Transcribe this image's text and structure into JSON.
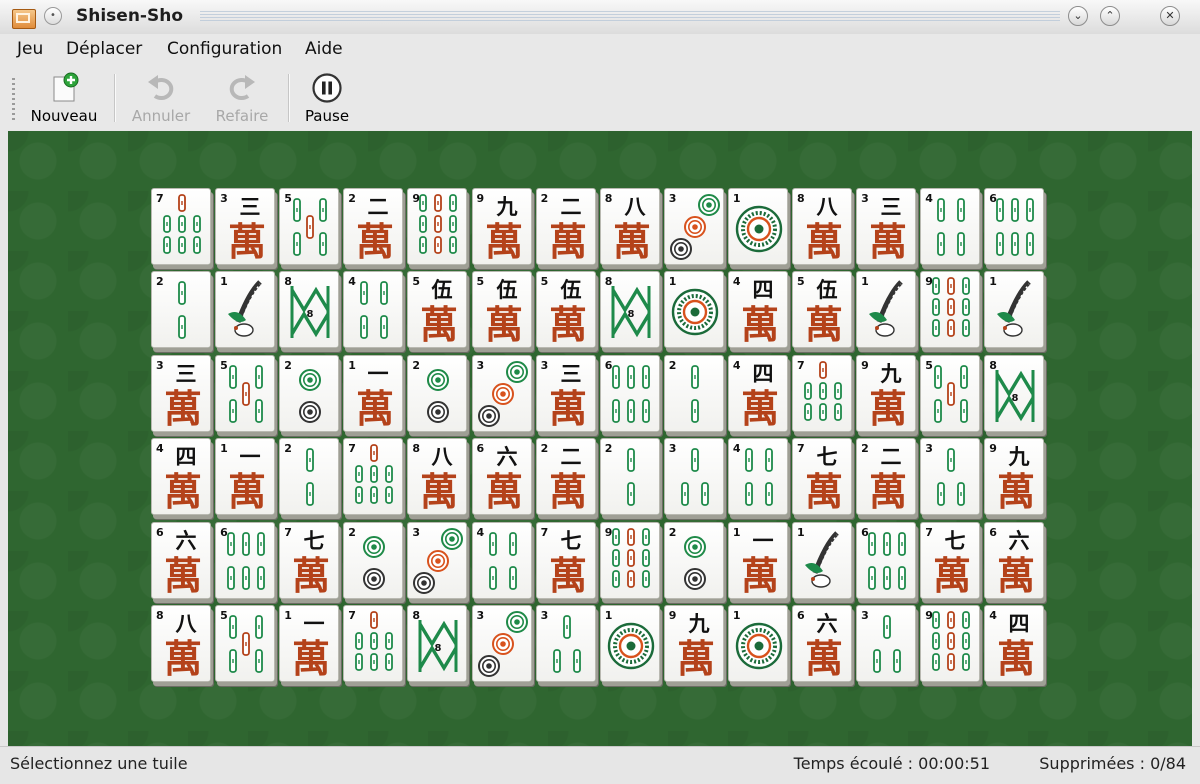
{
  "window": {
    "title": "Shisen-Sho"
  },
  "menu": [
    {
      "label": "Jeu",
      "key": "jeu"
    },
    {
      "label": "Déplacer",
      "key": "deplacer"
    },
    {
      "label": "Configuration",
      "key": "configuration"
    },
    {
      "label": "Aide",
      "key": "aide"
    }
  ],
  "toolbar": {
    "new_label": "Nouveau",
    "undo_label": "Annuler",
    "redo_label": "Refaire",
    "pause_label": "Pause",
    "undo_enabled": false,
    "redo_enabled": false
  },
  "status": {
    "message": "Sélectionnez une tuile",
    "elapsed": "Temps écoulé : 00:00:51",
    "removed": "Supprimées : 0/84"
  },
  "colors": {
    "felt": "#2f6630",
    "char_red": "#b4421a",
    "bamboo_green": "#1e8a4a",
    "circle_green": "#1f8a48",
    "circle_orange": "#d8521d"
  },
  "board": {
    "rows": [
      [
        "B7",
        "C3",
        "B5",
        "C2",
        "B9",
        "C9",
        "C2",
        "C8",
        "D3",
        "D1",
        "C8",
        "C3",
        "B4",
        "B6"
      ],
      [
        "B2",
        "B1",
        "B8",
        "B4",
        "C5",
        "C5",
        "C5",
        "B8",
        "D1",
        "C4",
        "C5",
        "B1",
        "B9",
        "B1"
      ],
      [
        "C3",
        "B5",
        "D2",
        "C1",
        "D2",
        "D3",
        "C3",
        "B6",
        "B2",
        "C4",
        "B7",
        "C9",
        "B5",
        "B8"
      ],
      [
        "C4",
        "C1",
        "B2",
        "B7",
        "C8",
        "C6",
        "C2",
        "B2",
        "B3",
        "B4",
        "C7",
        "C2",
        "B3",
        "C9"
      ],
      [
        "C6",
        "B6",
        "C7",
        "D2",
        "D3",
        "B4",
        "C7",
        "B9",
        "D2",
        "C1",
        "B1",
        "B6",
        "C7",
        "C6"
      ],
      [
        "C8",
        "B5",
        "C1",
        "B7",
        "B8",
        "D3",
        "B3",
        "D1",
        "C9",
        "D1",
        "C6",
        "B3",
        "B9",
        "C4"
      ]
    ]
  }
}
